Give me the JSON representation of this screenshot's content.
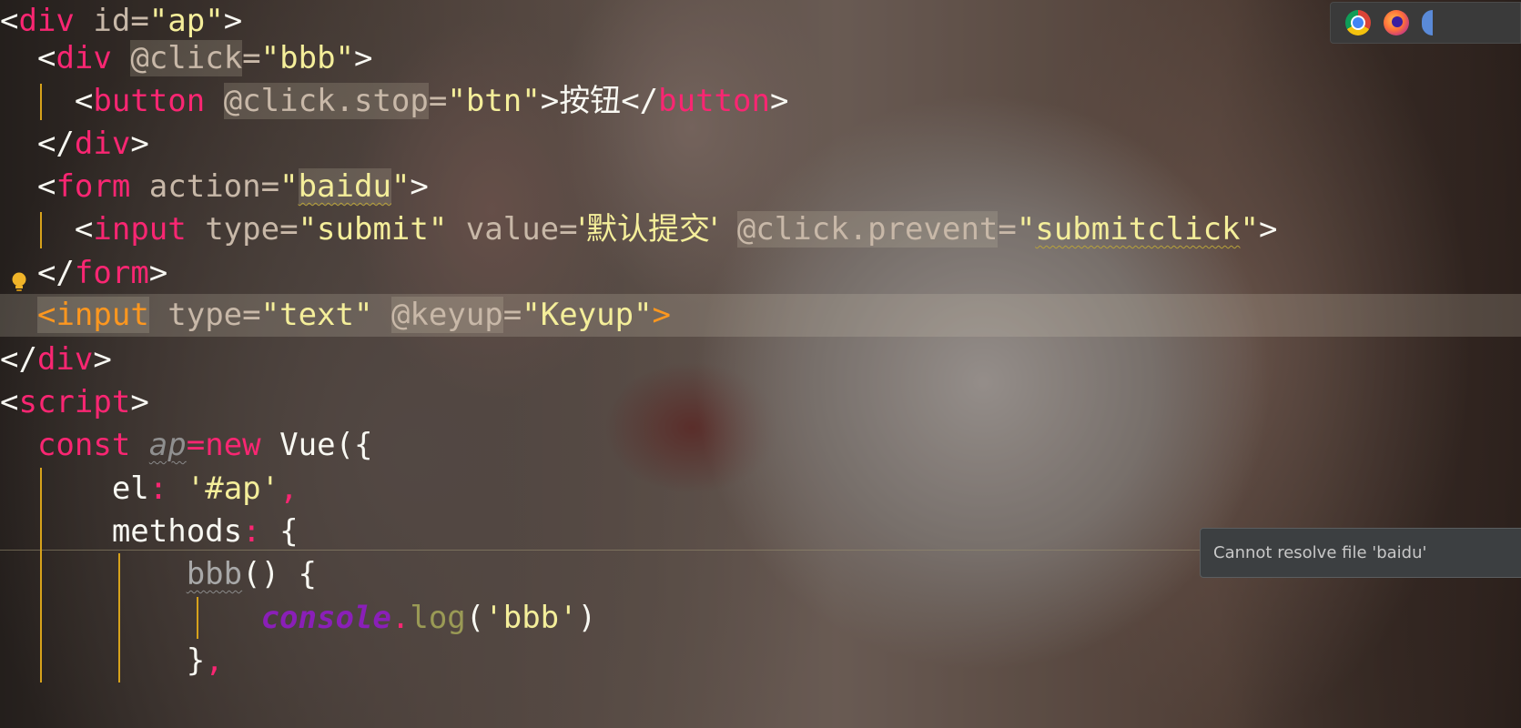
{
  "editor": {
    "lines": {
      "l1": {
        "open": "<",
        "tag": "div",
        "attr": " id=",
        "val": "\"ap\"",
        "close": ">"
      },
      "l2": {
        "indent": "  ",
        "open": "<",
        "tag": "div",
        "sp": " ",
        "attr": "@click",
        "eq": "=",
        "val": "\"bbb\"",
        "close": ">"
      },
      "l3": {
        "indent": "    ",
        "open": "<",
        "tag": "button",
        "sp": " ",
        "attr": "@click.stop",
        "eq": "=",
        "val": "\"btn\"",
        "mid": ">",
        "text": "按钮",
        "end_open": "</",
        "end_tag": "button",
        "end_close": ">"
      },
      "l4": {
        "indent": "  ",
        "open": "</",
        "tag": "div",
        "close": ">"
      },
      "l5": {
        "indent": "  ",
        "open": "<",
        "tag": "form",
        "attr": " action=",
        "q1": "\"",
        "val": "baidu",
        "q2": "\"",
        "close": ">"
      },
      "l6": {
        "indent": "    ",
        "open": "<",
        "tag": "input",
        "attr1": " type=",
        "val1": "\"submit\"",
        "attr2": " value=",
        "val2": "'默认提交'",
        "sp": " ",
        "attr3": "@click.prevent",
        "eq": "=",
        "q1": "\"",
        "val3": "submitclick",
        "q2": "\"",
        "close": ">"
      },
      "l7": {
        "indent": "  ",
        "open": "</",
        "tag": "form",
        "close": ">"
      },
      "l8": {
        "indent": "  ",
        "open": "<",
        "tag": "input",
        "attr1": " type=",
        "val1": "\"text\"",
        "sp": " ",
        "attr2": "@keyup",
        "eq": "=",
        "val2": "\"Keyup\"",
        "close": ">"
      },
      "l9": {
        "open": "</",
        "tag": "div",
        "close": ">"
      },
      "l10": {
        "open": "<",
        "tag": "script",
        "close": ">"
      },
      "l11": {
        "indent": "  ",
        "kw": "const",
        "sp": " ",
        "var": "ap",
        "eq": "=",
        "kw2": "new",
        "rest": " Vue({"
      },
      "l12": {
        "indent": "      ",
        "key": "el",
        "colon": ":",
        "sp": " ",
        "val": "'#ap'",
        "comma": ","
      },
      "l13": {
        "indent": "      ",
        "key": "methods",
        "colon": ":",
        "rest": " {"
      },
      "l14": {
        "indent": "          ",
        "fn": "bbb",
        "rest": "() {"
      },
      "l15": {
        "indent": "              ",
        "obj": "console",
        "dot": ".",
        "fn": "log",
        "p1": "(",
        "val": "'bbb'",
        "p2": ")"
      },
      "l16": {
        "indent": "          ",
        "text": "}",
        "comma": ","
      }
    }
  },
  "tooltip": {
    "text": "Cannot resolve file 'baidu'"
  },
  "browsers": {
    "icons": [
      "chrome-icon",
      "firefox-icon"
    ]
  },
  "colors": {
    "tag": "#f92672",
    "string": "#f4ee9a",
    "attr": "#c8b8a8",
    "guide": "#d7a21b",
    "console": "#8a1fb8"
  }
}
